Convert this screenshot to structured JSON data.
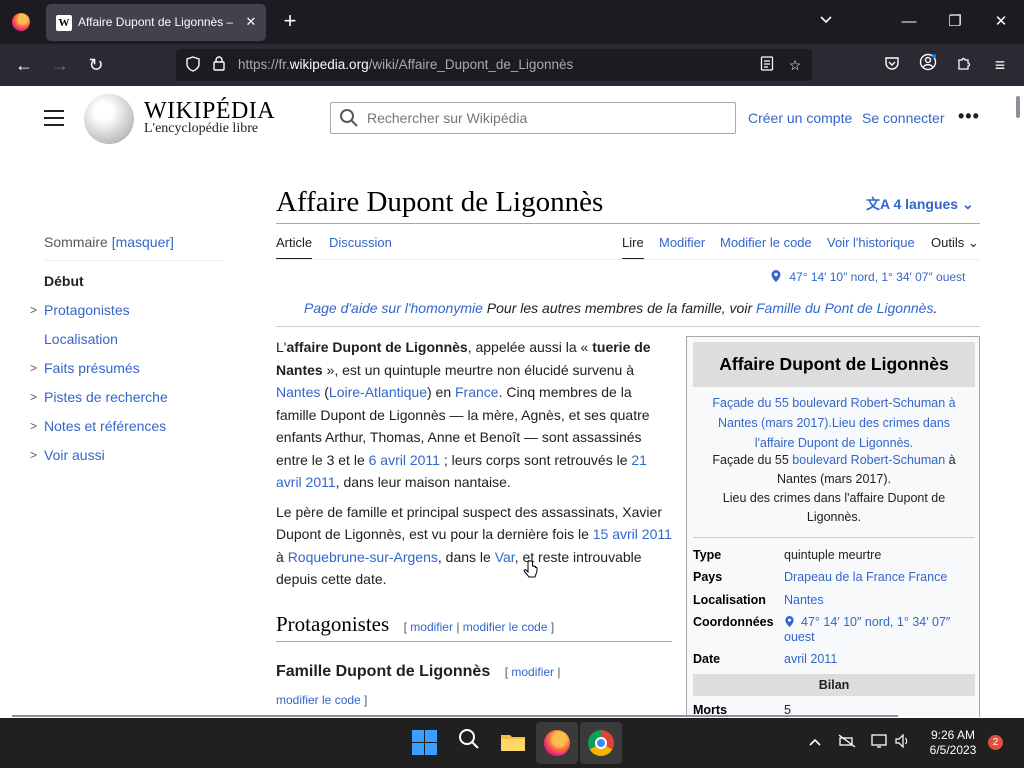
{
  "browser": {
    "tab_title": "Affaire Dupont de Ligonnès — Wikipédia",
    "tab_favicon": "W",
    "url_prefix": "https://fr.",
    "url_domain": "wikipedia.org",
    "url_path": "/wiki/Affaire_Dupont_de_Ligonnès"
  },
  "wiki": {
    "wordmark": "WIKIPÉDIA",
    "tagline": "L'encyclopédie libre",
    "search_placeholder": "Rechercher sur Wikipédia",
    "create_account": "Créer un compte",
    "login": "Se connecter"
  },
  "toc": {
    "heading": "Sommaire",
    "hide": "[masquer]",
    "items": [
      {
        "label": "Début",
        "bold": true,
        "chevron": false
      },
      {
        "label": "Protagonistes",
        "chevron": true
      },
      {
        "label": "Localisation",
        "chevron": false
      },
      {
        "label": "Faits présumés",
        "chevron": true
      },
      {
        "label": "Pistes de recherche",
        "chevron": true
      },
      {
        "label": "Notes et références",
        "chevron": true
      },
      {
        "label": "Voir aussi",
        "chevron": true
      }
    ]
  },
  "article": {
    "title": "Affaire Dupont de Ligonnès",
    "languages": "4 langues",
    "tabs": {
      "article": "Article",
      "discussion": "Discussion",
      "read": "Lire",
      "edit": "Modifier",
      "edit_source": "Modifier le code",
      "history": "Voir l'historique",
      "tools": "Outils"
    },
    "coordinates": "47° 14′ 10″ nord, 1° 34′ 07″ ouest",
    "hatnote": {
      "help": "Page d'aide sur l'homonymie",
      "text": "Pour les autres membres de la famille, voir",
      "link": "Famille du Pont de Ligonnès",
      "end": "."
    },
    "p1": {
      "a": "L'",
      "b": "affaire Dupont de Ligonnès",
      "c": ", appelée aussi la « ",
      "d": "tuerie de Nantes",
      "e": " », est un quintuple meurtre non élucidé survenu à ",
      "nantes": "Nantes",
      "f": " (",
      "la": "Loire-Atlantique",
      "g": ") en ",
      "france": "France",
      "h": ". Cinq membres de la famille Dupont de Ligonnès — la mère, Agnès, et ses quatre enfants Arthur, Thomas, Anne et Benoît — sont assassinés entre le 3 et le ",
      "date1": "6 avril 2011",
      "i": " ; leurs corps sont retrouvés le ",
      "date2": "21 avril 2011",
      "j": ", dans leur maison nantaise."
    },
    "p2": {
      "a": "Le père de famille et principal suspect des assassinats, Xavier Dupont de Ligonnès, est vu pour la dernière fois le ",
      "date": "15 avril 2011",
      "b": " à ",
      "place": "Roquebrune-sur-Argens",
      "c": ", dans le ",
      "var": "Var",
      "d": ", et reste introuvable depuis cette date."
    },
    "h2": "Protagonistes",
    "h2_open": "[ ",
    "h2_edit": "modifier",
    "h2_sep": " | ",
    "h2_edit_code": "modifier le code",
    "h2_close": " ]",
    "h3": "Famille Dupont de Ligonnès",
    "h3_open": "[ ",
    "h3_edit": "modifier",
    "h3_sep": " |",
    "h3_edit_code": "modifier le code",
    "h3_close": " ]"
  },
  "infobox": {
    "title": "Affaire Dupont de Ligonnès",
    "caption_link": "Façade du 55 boulevard Robert-Schuman à Nantes (mars 2017).Lieu des crimes dans l'affaire Dupont de Ligonnès.",
    "caption_a": "Façade du 55 ",
    "caption_link2": "boulevard Robert-Schuman",
    "caption_b": " à Nantes (mars 2017).",
    "caption_c": "Lieu des crimes dans l'affaire Dupont de Ligonnès.",
    "rows": {
      "type_k": "Type",
      "type_v": "quintuple meurtre",
      "pays_k": "Pays",
      "pays_v": "Drapeau de la France France",
      "loc_k": "Localisation",
      "loc_v": "Nantes",
      "coord_k": "Coordonnées",
      "coord_v": "47° 14′ 10″ nord, 1° 34′ 07″ ouest",
      "date_k": "Date",
      "date_v": "avril 2011",
      "bilan": "Bilan",
      "morts_k": "Morts",
      "morts_v": "5"
    }
  },
  "taskbar": {
    "time": "9:26 AM",
    "date": "6/5/2023",
    "notifications": "2"
  }
}
